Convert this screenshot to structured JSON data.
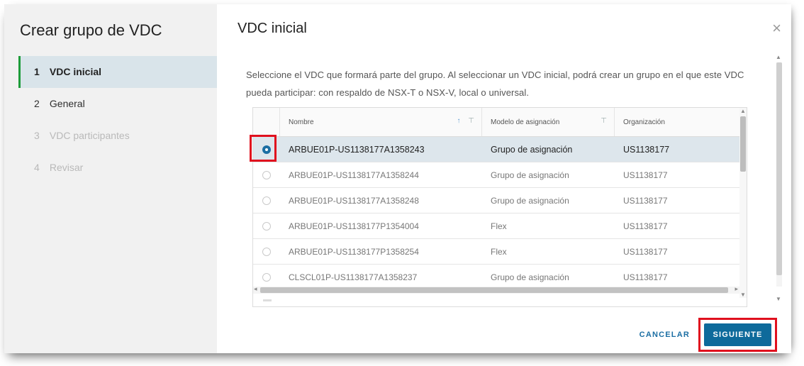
{
  "wizard": {
    "title": "Crear grupo de VDC",
    "steps": [
      {
        "num": "1",
        "label": "VDC inicial"
      },
      {
        "num": "2",
        "label": "General"
      },
      {
        "num": "3",
        "label": "VDC participantes"
      },
      {
        "num": "4",
        "label": "Revisar"
      }
    ]
  },
  "page": {
    "title": "VDC inicial",
    "close_icon": "×",
    "description": "Seleccione el VDC que formará parte del grupo. Al seleccionar un VDC inicial, podrá crear un grupo en el que este VDC pueda participar: con respaldo de NSX-T o NSX-V, local o universal."
  },
  "grid": {
    "columns": {
      "name": "Nombre",
      "model": "Modelo de asignación",
      "org": "Organización"
    },
    "sort_icon": "↑",
    "filter_icon": "⊤",
    "rows": [
      {
        "name": "ARBUE01P-US1138177A1358243",
        "model": "Grupo de asignación",
        "org": "US1138177"
      },
      {
        "name": "ARBUE01P-US1138177A1358244",
        "model": "Grupo de asignación",
        "org": "US1138177"
      },
      {
        "name": "ARBUE01P-US1138177A1358248",
        "model": "Grupo de asignación",
        "org": "US1138177"
      },
      {
        "name": "ARBUE01P-US1138177P1354004",
        "model": "Flex",
        "org": "US1138177"
      },
      {
        "name": "ARBUE01P-US1138177P1358254",
        "model": "Flex",
        "org": "US1138177"
      },
      {
        "name": "CLSCL01P-US1138177A1358237",
        "model": "Grupo de asignación",
        "org": "US1138177"
      }
    ],
    "selected_row": 0
  },
  "footer": {
    "cancel_label": "CANCELAR",
    "next_label": "SIGUIENTE"
  },
  "colors": {
    "primary": "#0e6a9b",
    "active_step_bar": "#1d9c3a",
    "highlight": "#e0101e",
    "selected_row": "#dde6ec"
  }
}
